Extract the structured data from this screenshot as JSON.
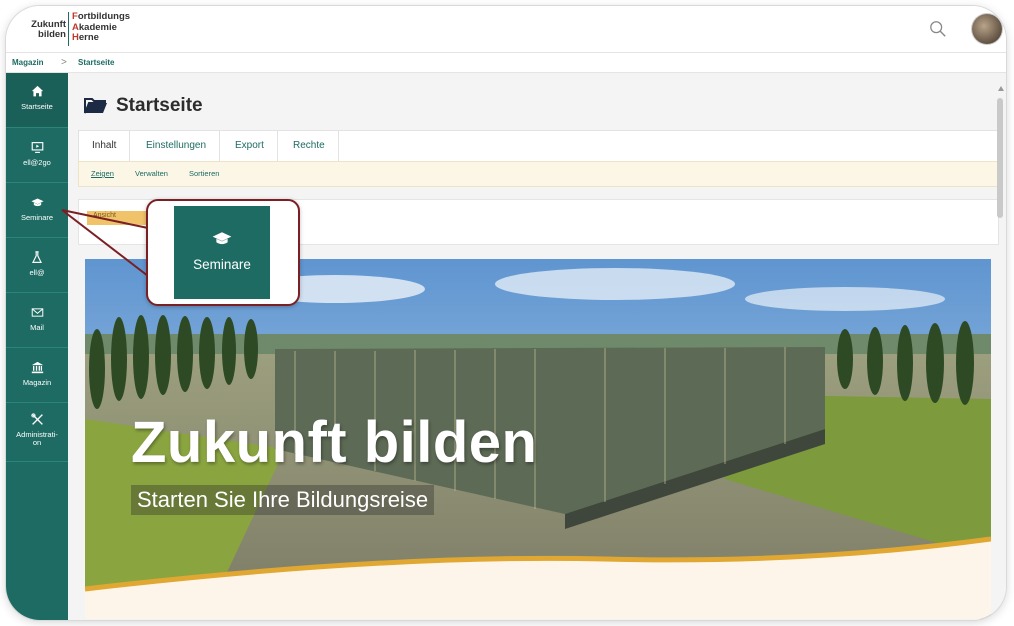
{
  "header": {
    "logo_left": "Zukunft bilden",
    "logo_right": [
      "Fortbildungs",
      "Akademie",
      "Herne"
    ],
    "search_icon": "search-icon",
    "avatar": "user-avatar"
  },
  "breadcrumb": {
    "items": [
      "Magazin",
      "Startseite"
    ],
    "separator": ">"
  },
  "sidebar": {
    "items": [
      {
        "label": "Startseite",
        "icon": "home-icon"
      },
      {
        "label": "ell@2go",
        "icon": "monitor-play-icon"
      },
      {
        "label": "Seminare",
        "icon": "graduation-cap-icon"
      },
      {
        "label": "ell@",
        "icon": "flask-icon"
      },
      {
        "label": "Mail",
        "icon": "mail-icon"
      },
      {
        "label": "Magazin",
        "icon": "bank-icon"
      },
      {
        "label": "Administrati-\non",
        "icon": "tools-icon"
      }
    ]
  },
  "main": {
    "page_title": "Startseite",
    "tabs": [
      "Inhalt",
      "Einstellungen",
      "Export",
      "Rechte"
    ],
    "subtabs": [
      "Zeigen",
      "Verwalten",
      "Sortieren"
    ],
    "notice": "Ansicht"
  },
  "hero": {
    "title": "Zukunft bilden",
    "subtitle": "Starten Sie Ihre Bildungsreise"
  },
  "callout": {
    "label": "Seminare",
    "icon": "graduation-cap-icon"
  },
  "colors": {
    "primary": "#1d6b63",
    "callout_border": "#7a1f24",
    "subtab_bg": "#fbf6e6"
  }
}
